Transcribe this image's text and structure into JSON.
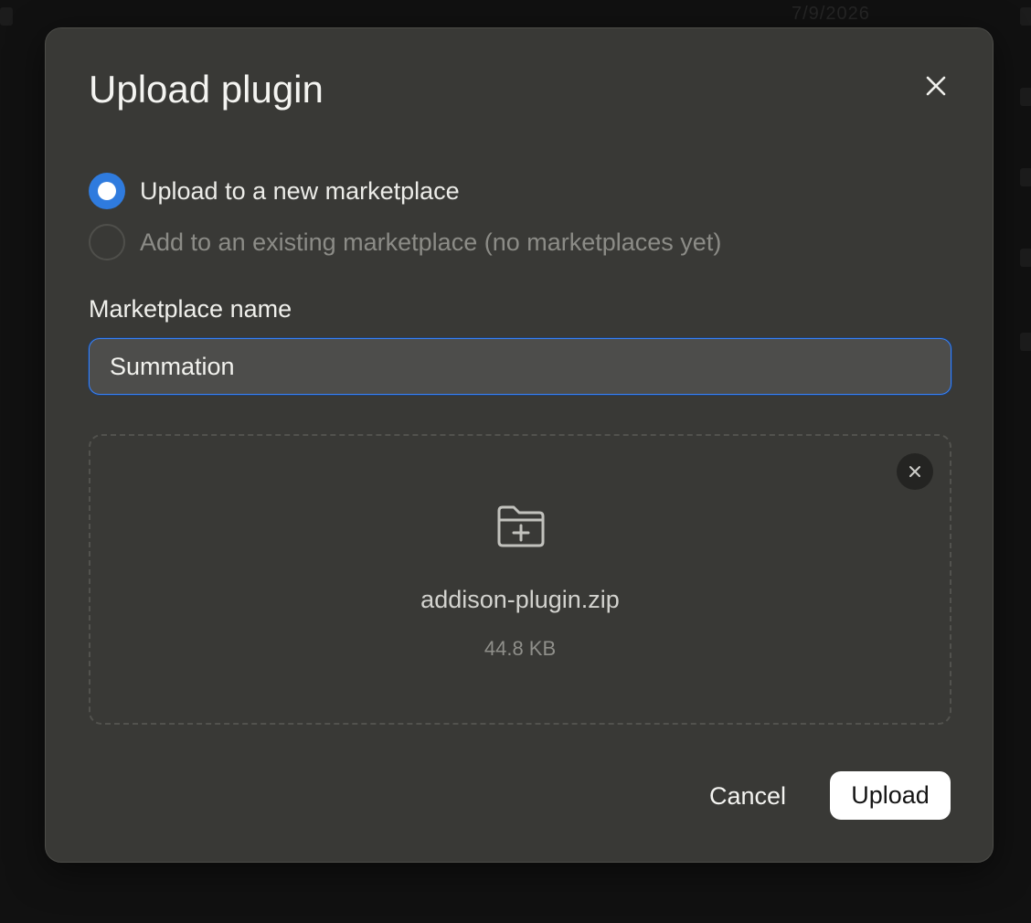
{
  "background": {
    "date_text": "7/9/2026"
  },
  "modal": {
    "title": "Upload plugin",
    "close_icon": "close-icon",
    "options": [
      {
        "label": "Upload to a new marketplace",
        "checked": true,
        "disabled": false
      },
      {
        "label": "Add to an existing marketplace (no marketplaces yet)",
        "checked": false,
        "disabled": true
      }
    ],
    "marketplace_name": {
      "label": "Marketplace name",
      "value": "Summation"
    },
    "file": {
      "name": "addison-plugin.zip",
      "size": "44.8 KB",
      "icon": "folder-plus-icon",
      "remove_icon": "close-icon"
    },
    "actions": {
      "cancel_label": "Cancel",
      "upload_label": "Upload"
    }
  },
  "colors": {
    "accent": "#2f7bde",
    "focus_ring": "#3b82f6",
    "modal_bg": "#393936",
    "primary_button_bg": "#ffffff"
  }
}
